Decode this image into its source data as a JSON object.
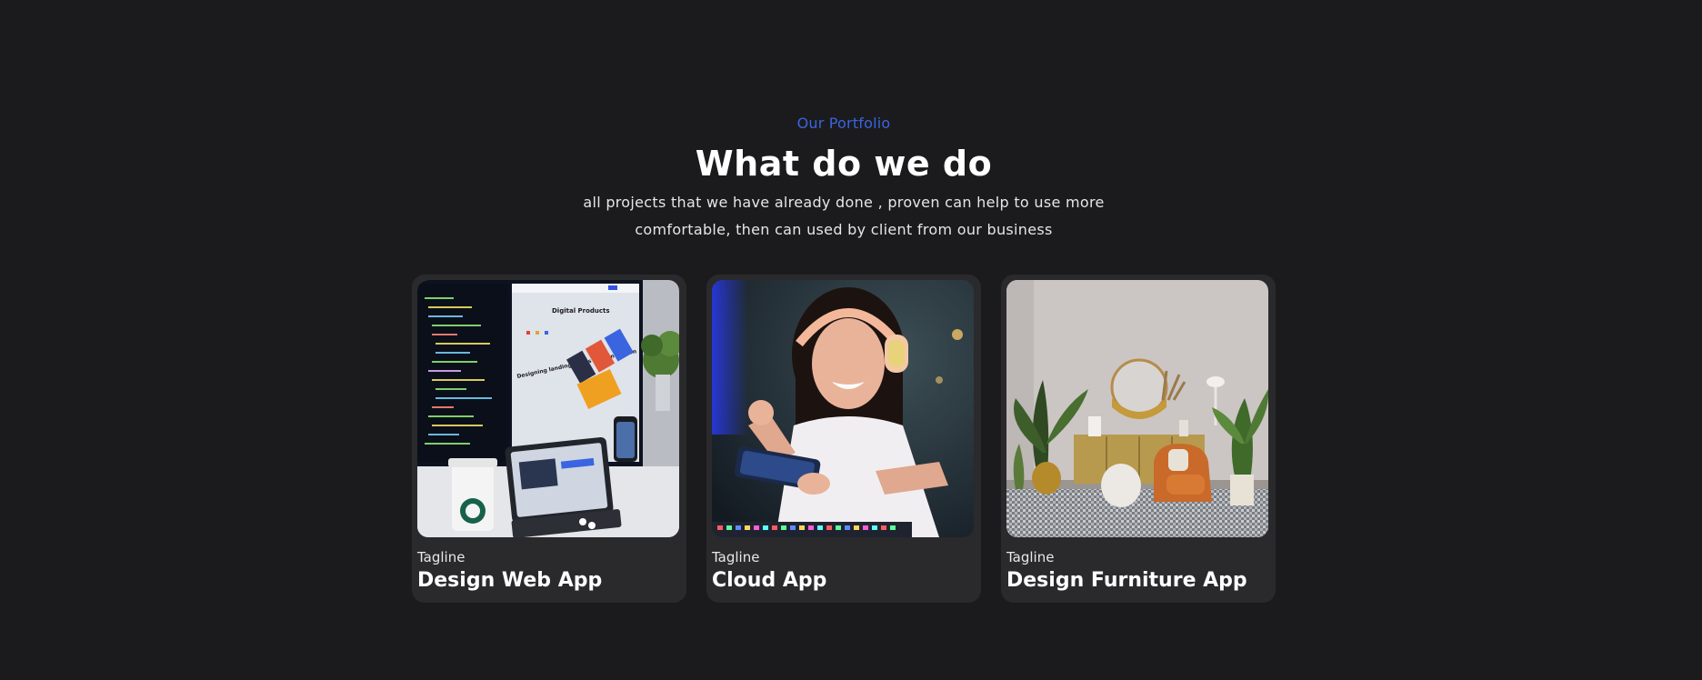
{
  "section": {
    "eyebrow": "Our Portfolio",
    "title": "What do we do",
    "subtitle": "all projects that we have already done , proven can help to use more comfortable, then can used by client from our business"
  },
  "cards": [
    {
      "tagline": "Tagline",
      "title": "Design Web App",
      "image": "workspace-monitor-tablet-photo",
      "screen_text": [
        "Digital Products",
        "Designing landing pages for conversion"
      ]
    },
    {
      "tagline": "Tagline",
      "title": "Cloud App",
      "image": "gamer-with-headphones-photo"
    },
    {
      "tagline": "Tagline",
      "title": "Design Furniture App",
      "image": "living-room-furniture-photo"
    }
  ],
  "colors": {
    "background": "#1b1b1d",
    "card": "#2a2a2c",
    "accent": "#3a64e0",
    "text": "#ffffff"
  }
}
